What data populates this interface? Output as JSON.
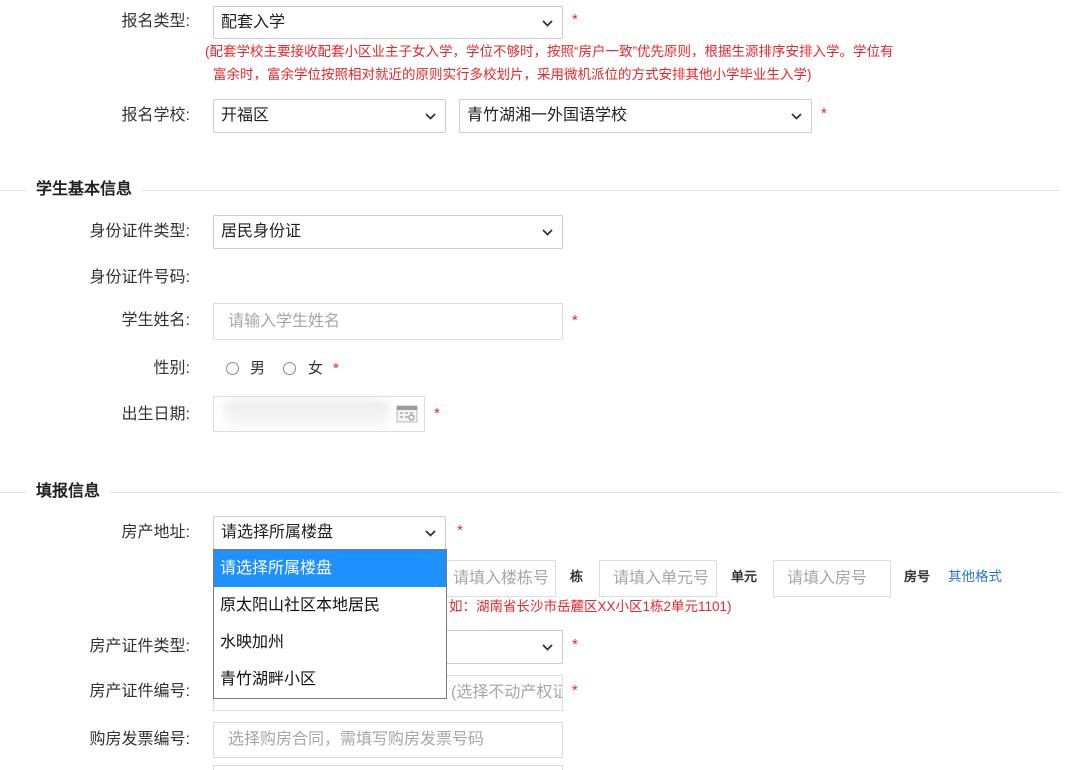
{
  "theme": {
    "required_color": "#e8262a",
    "link_color": "#2a74d8",
    "highlight_color": "#1e90ff",
    "label_color": "#333333"
  },
  "required_mark": "*",
  "enrollment": {
    "type_label": "报名类型:",
    "type_value": "配套入学",
    "notice": [
      "(配套学校主要接收配套小区业主子女入学，学位不够时，按照“房户一致”优先原则，根据生源排序安排入学。学位有",
      "富余时，富余学位按照相对就近的原则实行多校划片，采用微机派位的方式安排其他小学毕业生入学)"
    ],
    "school_label": "报名学校:",
    "district_value": "开福区",
    "school_value": "青竹湖湘一外国语学校"
  },
  "student": {
    "section_title": "学生基本信息",
    "id_type_label": "身份证件类型:",
    "id_type_value": "居民身份证",
    "id_number_label": "身份证件号码:",
    "name_label": "学生姓名:",
    "name_placeholder": "请输入学生姓名",
    "gender_label": "性别:",
    "gender_options": [
      "男",
      "女"
    ],
    "birth_label": "出生日期:"
  },
  "filing": {
    "section_title": "填报信息",
    "address_label": "房产地址:",
    "address_value": "请选择所属楼盘",
    "address_options": [
      "请选择所属楼盘",
      "原太阳山社区本地居民",
      "水映加州",
      "青竹湖畔小区"
    ],
    "building_placeholder": "请填入楼栋号",
    "building_suffix": "栋",
    "unit_placeholder": "请填入单元号",
    "unit_suffix": "单元",
    "room_placeholder": "请填入房号",
    "room_suffix": "房号",
    "other_format_link": "其他格式",
    "address_hint": "如：湖南省长沙市岳麓区XX小区1栋2单元1101)",
    "cert_type_label": "房产证件类型:",
    "cert_number_label": "房产证件编号:",
    "cert_number_placeholder": "(选择不动产权证",
    "invoice_label": "购房发票编号:",
    "invoice_placeholder": "选择购房合同，需填写购房发票号码"
  },
  "icons": {
    "select_arrow": "chevron-down-icon",
    "date_picker": "calendar-icon"
  }
}
